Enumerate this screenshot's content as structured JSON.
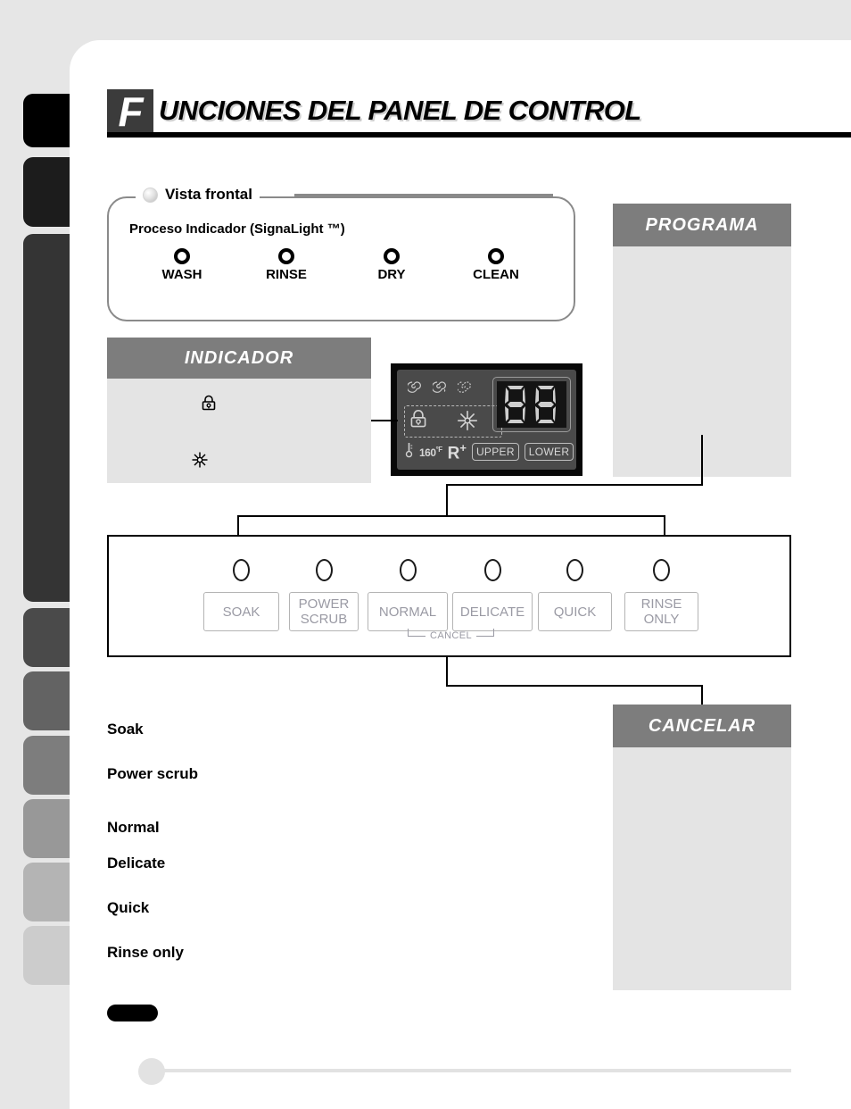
{
  "header": {
    "drop_cap": "F",
    "title": "UNCIONES DEL PANEL DE CONTROL"
  },
  "vista_frontal": {
    "label": "Vista frontal",
    "process_indicator_label": "Proceso Indicador (SignaLight ™)",
    "lights": [
      {
        "name": "WASH"
      },
      {
        "name": "RINSE"
      },
      {
        "name": "DRY"
      },
      {
        "name": "CLEAN"
      }
    ]
  },
  "panels": {
    "indicador": {
      "title": "INDICADOR",
      "icons": [
        "lock-icon",
        "star-icon"
      ]
    },
    "programa": {
      "title": "PROGRAMA"
    },
    "cancelar": {
      "title": "CANCELAR"
    }
  },
  "lcd": {
    "digits": "88",
    "temperature": "160",
    "temperature_unit": "°F",
    "rplus_letter": "R",
    "rplus_sup": "+",
    "upper_label": "UPPER",
    "lower_label": "LOWER",
    "icons": [
      "spiral-icon",
      "spiral-small-icon",
      "spiral-dotted-icon",
      "lock-icon",
      "star-icon",
      "thermometer-icon"
    ],
    "background_color": "#4a4a4a",
    "digit_color": "#d8d8d8"
  },
  "cycle_panel": {
    "buttons": [
      {
        "label": "SOAK",
        "label2": ""
      },
      {
        "label": "POWER",
        "label2": "SCRUB"
      },
      {
        "label": "NORMAL",
        "label2": ""
      },
      {
        "label": "DELICATE",
        "label2": ""
      },
      {
        "label": "QUICK",
        "label2": ""
      },
      {
        "label": "RINSE",
        "label2": "ONLY"
      }
    ],
    "cancel_label": "CANCEL"
  },
  "descriptions": [
    {
      "title": "Soak"
    },
    {
      "title": "Power scrub"
    },
    {
      "title": "Normal"
    },
    {
      "title": "Delicate"
    },
    {
      "title": "Quick"
    },
    {
      "title": "Rinse only"
    }
  ],
  "tabs": [
    {
      "color": "#000000"
    },
    {
      "color": "#1c1c1c"
    },
    {
      "color": "#343434"
    },
    {
      "color": "#4a4a4a"
    },
    {
      "color": "#636363"
    },
    {
      "color": "#7d7d7d"
    },
    {
      "color": "#989898"
    },
    {
      "color": "#b4b4b4"
    },
    {
      "color": "#cccccc"
    }
  ],
  "colors": {
    "panel_header": "#7d7d7d",
    "panel_body": "#e4e4e4",
    "page_background": "#e6e6e6"
  }
}
